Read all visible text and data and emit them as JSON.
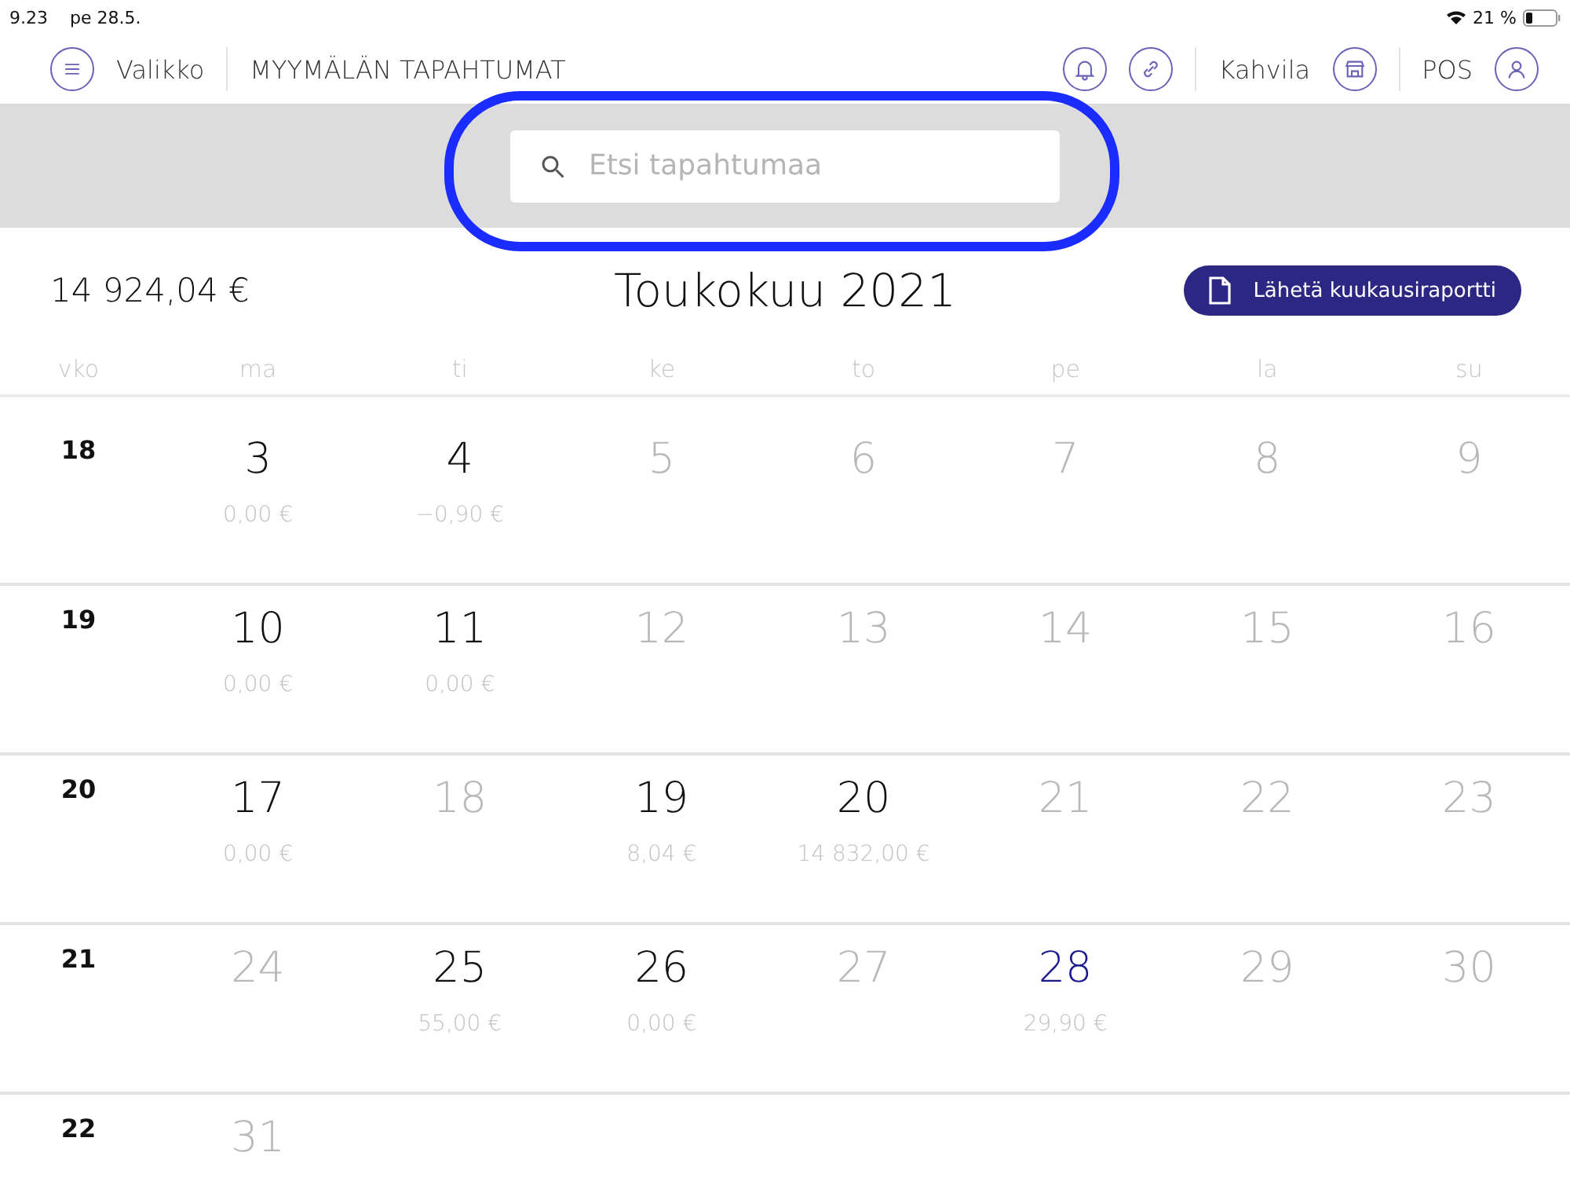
{
  "status_bar": {
    "time": "9.23",
    "date": "pe 28.5.",
    "battery": "21 %"
  },
  "header": {
    "menu_label": "Valikko",
    "title": "MYYMÄLÄN TAPAHTUMAT",
    "store": "Kahvila",
    "user": "POS"
  },
  "search": {
    "placeholder": "Etsi tapahtumaa"
  },
  "summary": {
    "total": "14 924,04 €",
    "month": "Toukokuu 2021",
    "report_button": "Lähetä kuukausiraportti"
  },
  "weekdays": [
    "vko",
    "ma",
    "ti",
    "ke",
    "to",
    "pe",
    "la",
    "su"
  ],
  "weeks": [
    {
      "week": "18",
      "days": [
        {
          "day": "3",
          "active": true,
          "today": false,
          "amount": "0,00 €"
        },
        {
          "day": "4",
          "active": true,
          "today": false,
          "amount": "−0,90 €"
        },
        {
          "day": "5",
          "active": false,
          "today": false
        },
        {
          "day": "6",
          "active": false,
          "today": false
        },
        {
          "day": "7",
          "active": false,
          "today": false
        },
        {
          "day": "8",
          "active": false,
          "today": false
        },
        {
          "day": "9",
          "active": false,
          "today": false
        }
      ]
    },
    {
      "week": "19",
      "days": [
        {
          "day": "10",
          "active": true,
          "today": false,
          "amount": "0,00 €"
        },
        {
          "day": "11",
          "active": true,
          "today": false,
          "amount": "0,00 €"
        },
        {
          "day": "12",
          "active": false,
          "today": false
        },
        {
          "day": "13",
          "active": false,
          "today": false
        },
        {
          "day": "14",
          "active": false,
          "today": false
        },
        {
          "day": "15",
          "active": false,
          "today": false
        },
        {
          "day": "16",
          "active": false,
          "today": false
        }
      ]
    },
    {
      "week": "20",
      "days": [
        {
          "day": "17",
          "active": true,
          "today": false,
          "amount": "0,00 €"
        },
        {
          "day": "18",
          "active": false,
          "today": false
        },
        {
          "day": "19",
          "active": true,
          "today": false,
          "amount": "8,04 €"
        },
        {
          "day": "20",
          "active": true,
          "today": false,
          "amount": "14 832,00 €"
        },
        {
          "day": "21",
          "active": false,
          "today": false
        },
        {
          "day": "22",
          "active": false,
          "today": false
        },
        {
          "day": "23",
          "active": false,
          "today": false
        }
      ]
    },
    {
      "week": "21",
      "days": [
        {
          "day": "24",
          "active": false,
          "today": false
        },
        {
          "day": "25",
          "active": true,
          "today": false,
          "amount": "55,00 €"
        },
        {
          "day": "26",
          "active": true,
          "today": false,
          "amount": "0,00 €"
        },
        {
          "day": "27",
          "active": false,
          "today": false
        },
        {
          "day": "28",
          "active": true,
          "today": true,
          "amount": "29,90 €"
        },
        {
          "day": "29",
          "active": false,
          "today": false
        },
        {
          "day": "30",
          "active": false,
          "today": false
        }
      ]
    },
    {
      "week": "22",
      "days": [
        {
          "day": "31",
          "active": false,
          "today": false
        }
      ]
    }
  ]
}
